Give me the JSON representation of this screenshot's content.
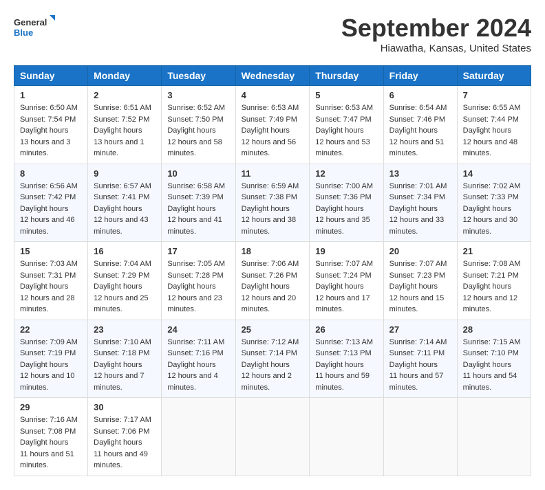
{
  "logo": {
    "line1": "General",
    "line2": "Blue"
  },
  "title": "September 2024",
  "location": "Hiawatha, Kansas, United States",
  "headers": [
    "Sunday",
    "Monday",
    "Tuesday",
    "Wednesday",
    "Thursday",
    "Friday",
    "Saturday"
  ],
  "weeks": [
    [
      {
        "day": "1",
        "sunrise": "6:50 AM",
        "sunset": "7:54 PM",
        "daylight": "13 hours and 3 minutes."
      },
      {
        "day": "2",
        "sunrise": "6:51 AM",
        "sunset": "7:52 PM",
        "daylight": "13 hours and 1 minute."
      },
      {
        "day": "3",
        "sunrise": "6:52 AM",
        "sunset": "7:50 PM",
        "daylight": "12 hours and 58 minutes."
      },
      {
        "day": "4",
        "sunrise": "6:53 AM",
        "sunset": "7:49 PM",
        "daylight": "12 hours and 56 minutes."
      },
      {
        "day": "5",
        "sunrise": "6:53 AM",
        "sunset": "7:47 PM",
        "daylight": "12 hours and 53 minutes."
      },
      {
        "day": "6",
        "sunrise": "6:54 AM",
        "sunset": "7:46 PM",
        "daylight": "12 hours and 51 minutes."
      },
      {
        "day": "7",
        "sunrise": "6:55 AM",
        "sunset": "7:44 PM",
        "daylight": "12 hours and 48 minutes."
      }
    ],
    [
      {
        "day": "8",
        "sunrise": "6:56 AM",
        "sunset": "7:42 PM",
        "daylight": "12 hours and 46 minutes."
      },
      {
        "day": "9",
        "sunrise": "6:57 AM",
        "sunset": "7:41 PM",
        "daylight": "12 hours and 43 minutes."
      },
      {
        "day": "10",
        "sunrise": "6:58 AM",
        "sunset": "7:39 PM",
        "daylight": "12 hours and 41 minutes."
      },
      {
        "day": "11",
        "sunrise": "6:59 AM",
        "sunset": "7:38 PM",
        "daylight": "12 hours and 38 minutes."
      },
      {
        "day": "12",
        "sunrise": "7:00 AM",
        "sunset": "7:36 PM",
        "daylight": "12 hours and 35 minutes."
      },
      {
        "day": "13",
        "sunrise": "7:01 AM",
        "sunset": "7:34 PM",
        "daylight": "12 hours and 33 minutes."
      },
      {
        "day": "14",
        "sunrise": "7:02 AM",
        "sunset": "7:33 PM",
        "daylight": "12 hours and 30 minutes."
      }
    ],
    [
      {
        "day": "15",
        "sunrise": "7:03 AM",
        "sunset": "7:31 PM",
        "daylight": "12 hours and 28 minutes."
      },
      {
        "day": "16",
        "sunrise": "7:04 AM",
        "sunset": "7:29 PM",
        "daylight": "12 hours and 25 minutes."
      },
      {
        "day": "17",
        "sunrise": "7:05 AM",
        "sunset": "7:28 PM",
        "daylight": "12 hours and 23 minutes."
      },
      {
        "day": "18",
        "sunrise": "7:06 AM",
        "sunset": "7:26 PM",
        "daylight": "12 hours and 20 minutes."
      },
      {
        "day": "19",
        "sunrise": "7:07 AM",
        "sunset": "7:24 PM",
        "daylight": "12 hours and 17 minutes."
      },
      {
        "day": "20",
        "sunrise": "7:07 AM",
        "sunset": "7:23 PM",
        "daylight": "12 hours and 15 minutes."
      },
      {
        "day": "21",
        "sunrise": "7:08 AM",
        "sunset": "7:21 PM",
        "daylight": "12 hours and 12 minutes."
      }
    ],
    [
      {
        "day": "22",
        "sunrise": "7:09 AM",
        "sunset": "7:19 PM",
        "daylight": "12 hours and 10 minutes."
      },
      {
        "day": "23",
        "sunrise": "7:10 AM",
        "sunset": "7:18 PM",
        "daylight": "12 hours and 7 minutes."
      },
      {
        "day": "24",
        "sunrise": "7:11 AM",
        "sunset": "7:16 PM",
        "daylight": "12 hours and 4 minutes."
      },
      {
        "day": "25",
        "sunrise": "7:12 AM",
        "sunset": "7:14 PM",
        "daylight": "12 hours and 2 minutes."
      },
      {
        "day": "26",
        "sunrise": "7:13 AM",
        "sunset": "7:13 PM",
        "daylight": "11 hours and 59 minutes."
      },
      {
        "day": "27",
        "sunrise": "7:14 AM",
        "sunset": "7:11 PM",
        "daylight": "11 hours and 57 minutes."
      },
      {
        "day": "28",
        "sunrise": "7:15 AM",
        "sunset": "7:10 PM",
        "daylight": "11 hours and 54 minutes."
      }
    ],
    [
      {
        "day": "29",
        "sunrise": "7:16 AM",
        "sunset": "7:08 PM",
        "daylight": "11 hours and 51 minutes."
      },
      {
        "day": "30",
        "sunrise": "7:17 AM",
        "sunset": "7:06 PM",
        "daylight": "11 hours and 49 minutes."
      },
      null,
      null,
      null,
      null,
      null
    ]
  ]
}
